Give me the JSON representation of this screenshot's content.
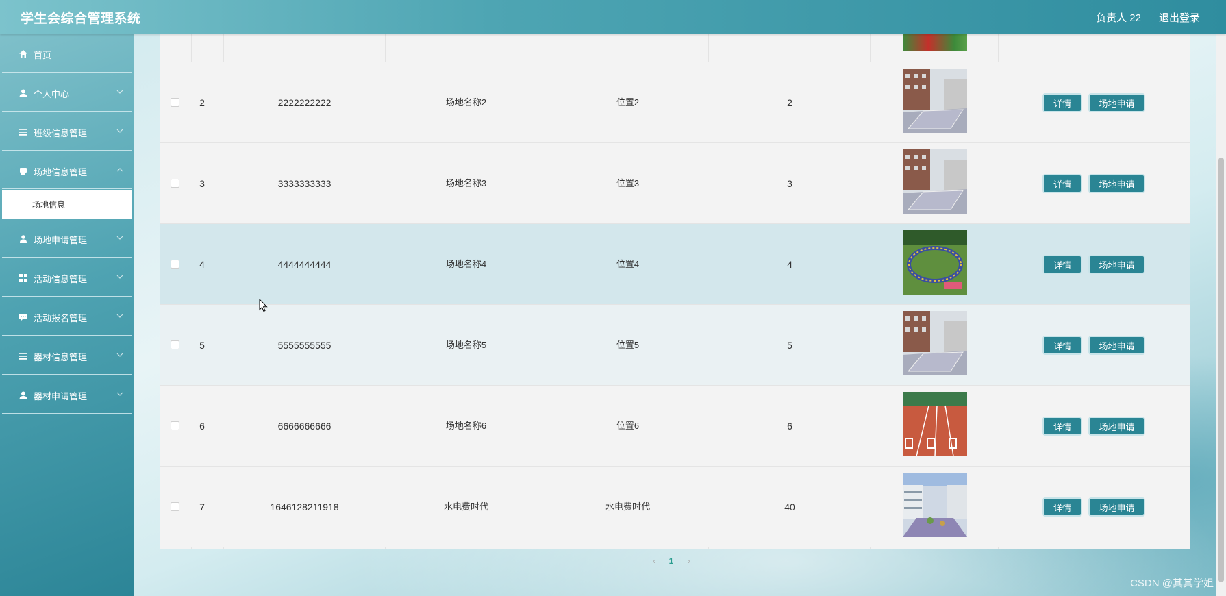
{
  "header": {
    "app_title": "学生会综合管理系统",
    "user_label": "负责人 22",
    "logout_label": "退出登录"
  },
  "sidebar": {
    "items": [
      {
        "label": "首页",
        "icon": "home-icon"
      },
      {
        "label": "个人中心",
        "icon": "user-icon"
      },
      {
        "label": "班级信息管理",
        "icon": "list-icon"
      },
      {
        "label": "场地信息管理",
        "icon": "venue-icon",
        "children": [
          {
            "label": "场地信息"
          }
        ]
      },
      {
        "label": "场地申请管理",
        "icon": "user-upload-icon"
      },
      {
        "label": "活动信息管理",
        "icon": "grid-icon"
      },
      {
        "label": "活动报名管理",
        "icon": "chat-icon"
      },
      {
        "label": "器材信息管理",
        "icon": "list-icon"
      },
      {
        "label": "器材申请管理",
        "icon": "user-icon"
      }
    ]
  },
  "table": {
    "rows": [
      {
        "index": "2",
        "number": "2222222222",
        "name": "场地名称2",
        "location": "位置2",
        "capacity": "2",
        "image": "building-court"
      },
      {
        "index": "3",
        "number": "3333333333",
        "name": "场地名称3",
        "location": "位置3",
        "capacity": "3",
        "image": "building-court"
      },
      {
        "index": "4",
        "number": "4444444444",
        "name": "场地名称4",
        "location": "位置4",
        "capacity": "4",
        "image": "crowd-circle"
      },
      {
        "index": "5",
        "number": "5555555555",
        "name": "场地名称5",
        "location": "位置5",
        "capacity": "5",
        "image": "building-court"
      },
      {
        "index": "6",
        "number": "6666666666",
        "name": "场地名称6",
        "location": "位置6",
        "capacity": "6",
        "image": "running-track"
      },
      {
        "index": "7",
        "number": "1646128211918",
        "name": "水电费时代",
        "location": "水电费时代",
        "capacity": "40",
        "image": "courtyard"
      }
    ],
    "actions": {
      "detail_label": "详情",
      "apply_label": "场地申请"
    }
  },
  "pagination": {
    "prev": "‹",
    "current": "1",
    "next": "›"
  },
  "watermark": "CSDN @其其学姐",
  "colors": {
    "accent": "#2a8594",
    "header_start": "#7cc3cc",
    "header_end": "#2f8d9f",
    "hover_row": "#d3e7ec"
  }
}
